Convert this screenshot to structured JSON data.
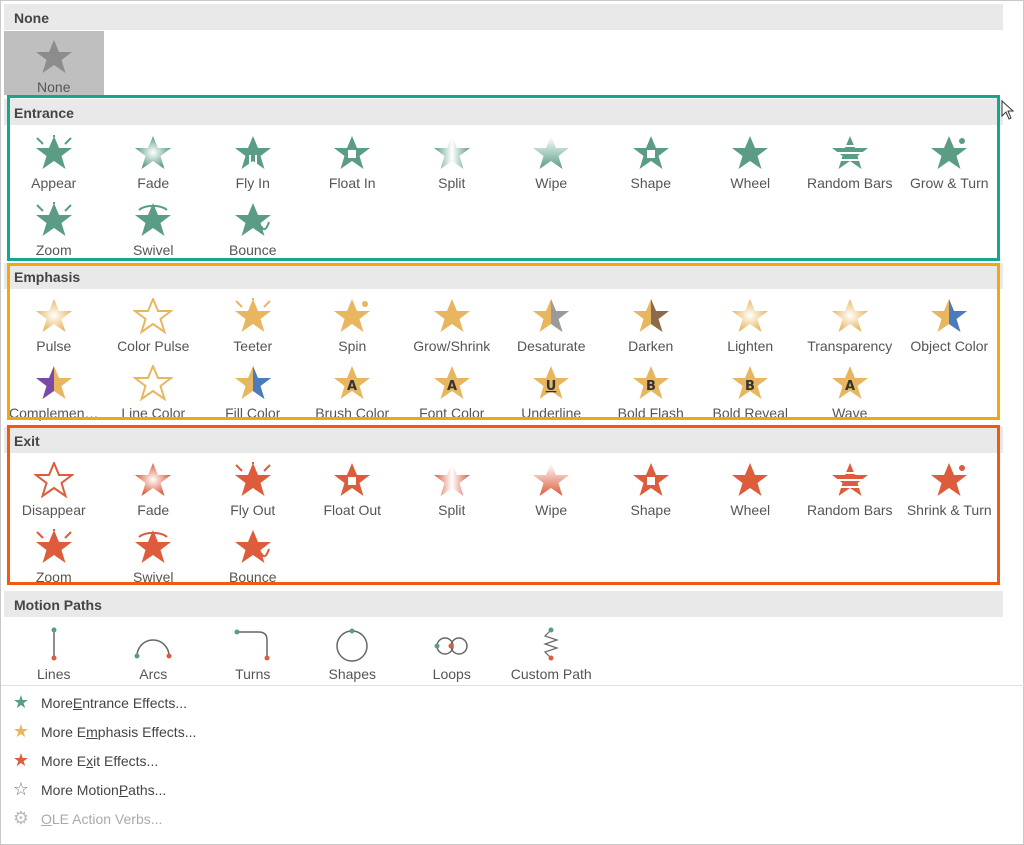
{
  "colors": {
    "entrance": "#5a9c84",
    "emphasis": "#e9b660",
    "exit": "#dc5c3c",
    "entrance_box": "#13a88a",
    "emphasis_box": "#f2a70f",
    "exit_box": "#f05a14"
  },
  "sections": {
    "none": {
      "title": "None",
      "items": [
        {
          "label": "None",
          "icon": "gray-star-icon"
        }
      ]
    },
    "entrance": {
      "title": "Entrance",
      "items": [
        {
          "label": "Appear",
          "icon": "appear-star-icon"
        },
        {
          "label": "Fade",
          "icon": "fade-star-icon"
        },
        {
          "label": "Fly In",
          "icon": "fly-in-star-icon"
        },
        {
          "label": "Float In",
          "icon": "float-in-star-icon"
        },
        {
          "label": "Split",
          "icon": "split-star-icon"
        },
        {
          "label": "Wipe",
          "icon": "wipe-star-icon"
        },
        {
          "label": "Shape",
          "icon": "shape-star-icon"
        },
        {
          "label": "Wheel",
          "icon": "wheel-star-icon"
        },
        {
          "label": "Random Bars",
          "icon": "random-bars-star-icon"
        },
        {
          "label": "Grow & Turn",
          "icon": "grow-turn-star-icon"
        },
        {
          "label": "Zoom",
          "icon": "zoom-star-icon"
        },
        {
          "label": "Swivel",
          "icon": "swivel-star-icon"
        },
        {
          "label": "Bounce",
          "icon": "bounce-star-icon"
        }
      ]
    },
    "emphasis": {
      "title": "Emphasis",
      "items": [
        {
          "label": "Pulse",
          "icon": "pulse-star-icon"
        },
        {
          "label": "Color Pulse",
          "icon": "color-pulse-star-icon"
        },
        {
          "label": "Teeter",
          "icon": "teeter-star-icon"
        },
        {
          "label": "Spin",
          "icon": "spin-star-icon"
        },
        {
          "label": "Grow/Shrink",
          "icon": "grow-shrink-star-icon"
        },
        {
          "label": "Desaturate",
          "icon": "desaturate-star-icon"
        },
        {
          "label": "Darken",
          "icon": "darken-star-icon"
        },
        {
          "label": "Lighten",
          "icon": "lighten-star-icon"
        },
        {
          "label": "Transparency",
          "icon": "transparency-star-icon"
        },
        {
          "label": "Object Color",
          "icon": "object-color-star-icon"
        },
        {
          "label": "Complemen…",
          "icon": "complementary-color-star-icon"
        },
        {
          "label": "Line Color",
          "icon": "line-color-star-icon"
        },
        {
          "label": "Fill Color",
          "icon": "fill-color-star-icon"
        },
        {
          "label": "Brush Color",
          "icon": "brush-color-star-icon"
        },
        {
          "label": "Font Color",
          "icon": "font-color-star-icon"
        },
        {
          "label": "Underline",
          "icon": "underline-star-icon"
        },
        {
          "label": "Bold Flash",
          "icon": "bold-flash-star-icon"
        },
        {
          "label": "Bold Reveal",
          "icon": "bold-reveal-star-icon"
        },
        {
          "label": "Wave",
          "icon": "wave-star-icon"
        }
      ]
    },
    "exit": {
      "title": "Exit",
      "items": [
        {
          "label": "Disappear",
          "icon": "disappear-star-icon"
        },
        {
          "label": "Fade",
          "icon": "fade-star-icon"
        },
        {
          "label": "Fly Out",
          "icon": "fly-out-star-icon"
        },
        {
          "label": "Float Out",
          "icon": "float-out-star-icon"
        },
        {
          "label": "Split",
          "icon": "split-star-icon"
        },
        {
          "label": "Wipe",
          "icon": "wipe-star-icon"
        },
        {
          "label": "Shape",
          "icon": "shape-star-icon"
        },
        {
          "label": "Wheel",
          "icon": "wheel-star-icon"
        },
        {
          "label": "Random Bars",
          "icon": "random-bars-star-icon"
        },
        {
          "label": "Shrink & Turn",
          "icon": "shrink-turn-star-icon"
        },
        {
          "label": "Zoom",
          "icon": "zoom-star-icon"
        },
        {
          "label": "Swivel",
          "icon": "swivel-star-icon"
        },
        {
          "label": "Bounce",
          "icon": "bounce-star-icon"
        }
      ]
    },
    "motion": {
      "title": "Motion Paths",
      "items": [
        {
          "label": "Lines",
          "icon": "line-path-icon"
        },
        {
          "label": "Arcs",
          "icon": "arc-path-icon"
        },
        {
          "label": "Turns",
          "icon": "turn-path-icon"
        },
        {
          "label": "Shapes",
          "icon": "circle-path-icon"
        },
        {
          "label": "Loops",
          "icon": "loop-path-icon"
        },
        {
          "label": "Custom Path",
          "icon": "custom-path-icon"
        }
      ]
    }
  },
  "more_links": [
    {
      "pre": "More ",
      "ul": "E",
      "post": "ntrance Effects...",
      "icon": "green-star-icon"
    },
    {
      "pre": "More E",
      "ul": "m",
      "post": "phasis Effects...",
      "icon": "gold-star-icon"
    },
    {
      "pre": "More E",
      "ul": "x",
      "post": "it Effects...",
      "icon": "red-star-icon"
    },
    {
      "pre": "More Motion ",
      "ul": "P",
      "post": "aths...",
      "icon": "outline-star-icon"
    },
    {
      "pre": "",
      "ul": "O",
      "post": "LE Action Verbs...",
      "icon": "gears-icon",
      "disabled": true
    }
  ]
}
